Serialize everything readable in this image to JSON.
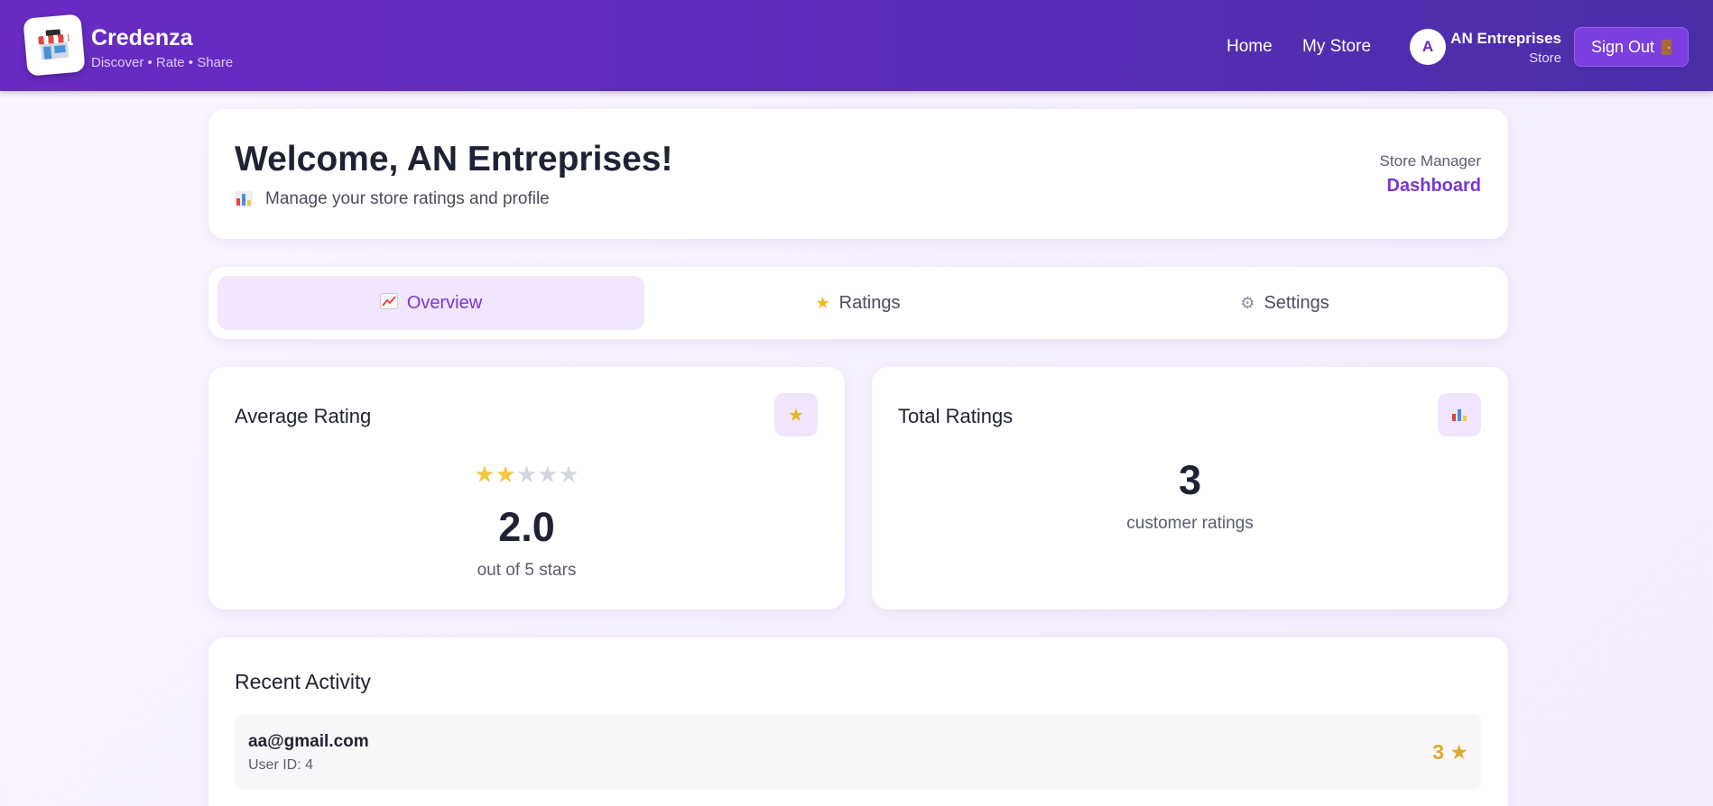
{
  "header": {
    "brand_name": "Credenza",
    "brand_tagline": "Discover • Rate • Share",
    "nav": {
      "home": "Home",
      "my_store": "My Store"
    },
    "user": {
      "initial": "A",
      "name": "AN Entreprises",
      "role": "Store"
    },
    "signout_label": "Sign Out"
  },
  "welcome": {
    "title": "Welcome, AN Entreprises!",
    "subtitle": "Manage your store ratings and profile",
    "role_label": "Store Manager",
    "dashboard_label": "Dashboard"
  },
  "tabs": [
    {
      "label": "Overview",
      "icon": "chart-up-icon",
      "active": true
    },
    {
      "label": "Ratings",
      "icon": "star-icon",
      "active": false
    },
    {
      "label": "Settings",
      "icon": "gear-icon",
      "active": false
    }
  ],
  "stats": {
    "average": {
      "title": "Average Rating",
      "value": "2.0",
      "subtitle": "out of 5 stars",
      "stars_filled": 2,
      "stars_total": 5
    },
    "total": {
      "title": "Total Ratings",
      "value": "3",
      "subtitle": "customer ratings"
    }
  },
  "activity": {
    "title": "Recent Activity",
    "items": [
      {
        "email": "aa@gmail.com",
        "user_id": "User ID: 4",
        "rating": "3 ★"
      }
    ]
  },
  "colors": {
    "accent": "#7a35d6",
    "header_start": "#6a2bc4",
    "header_end": "#4a2ea8",
    "star": "#f2c744",
    "rating_text": "#e0a82a"
  }
}
